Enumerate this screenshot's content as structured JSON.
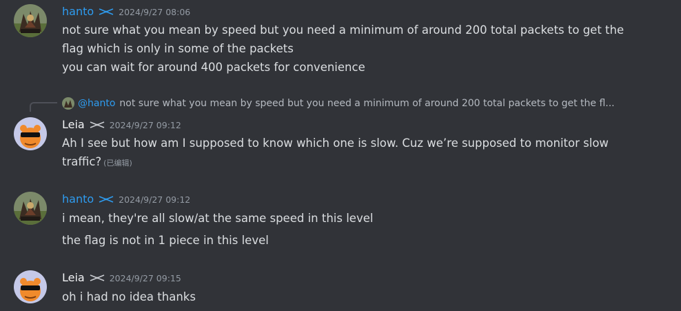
{
  "messages": [
    {
      "author": "hanto",
      "timestamp": "2024/9/27 08:06",
      "lines": [
        "not sure what you mean by speed but you need a minimum of around 200 total packets to get the",
        "flag which is only in some of the packets",
        "you can wait for around 400 packets for convenience"
      ]
    },
    {
      "reply": {
        "mention": "@hanto",
        "text": "not sure what you mean by speed but you need a minimum of around 200 total packets to get the fl..."
      },
      "author": "Leia",
      "timestamp": "2024/9/27 09:12",
      "lines": [
        "Ah I see but how am I supposed to know which one is slow. Cuz we’re supposed to monitor slow",
        "traffic?"
      ],
      "edited": "(已编辑)"
    },
    {
      "author": "hanto",
      "timestamp": "2024/9/27 09:12",
      "lines": [
        "i mean, they're all slow/at the same speed in this level",
        "the flag is not in 1 piece in this level"
      ]
    },
    {
      "author": "Leia",
      "timestamp": "2024/9/27 09:15",
      "lines": [
        "oh i had no idea thanks"
      ]
    }
  ],
  "colors": {
    "background": "#313338",
    "hanto_name": "#2e9cf0",
    "leia_name": "#f2f3f5",
    "text": "#dbdee1",
    "timestamp": "#949ba4"
  },
  "icons": {
    "role_badge": "scissors-icon"
  }
}
